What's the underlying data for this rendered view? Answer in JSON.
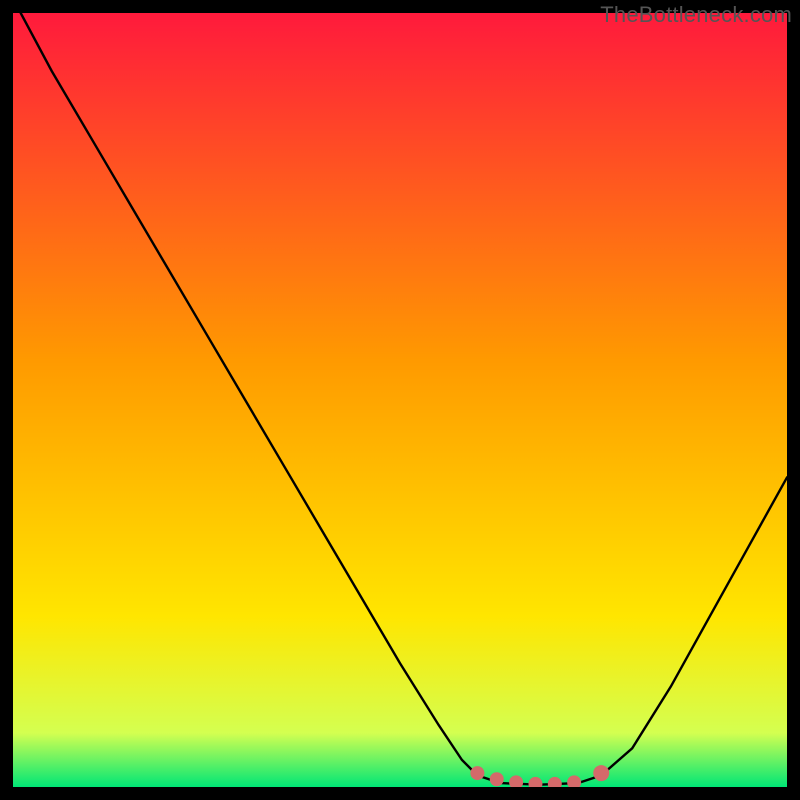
{
  "watermark": "TheBottleneck.com",
  "chart_data": {
    "type": "line",
    "title": "",
    "xlabel": "",
    "ylabel": "",
    "xlim": [
      0,
      100
    ],
    "ylim": [
      0,
      100
    ],
    "background_gradient": {
      "top": "#ff1a3c",
      "mid1": "#ff9a00",
      "mid2": "#ffe600",
      "bottom": "#00e676"
    },
    "series": [
      {
        "name": "curve",
        "color": "#000000",
        "points": [
          {
            "x": 1.0,
            "y": 100.0
          },
          {
            "x": 5.0,
            "y": 92.5
          },
          {
            "x": 10.0,
            "y": 84.0
          },
          {
            "x": 15.0,
            "y": 75.5
          },
          {
            "x": 20.0,
            "y": 67.0
          },
          {
            "x": 25.0,
            "y": 58.5
          },
          {
            "x": 30.0,
            "y": 50.0
          },
          {
            "x": 35.0,
            "y": 41.5
          },
          {
            "x": 40.0,
            "y": 33.0
          },
          {
            "x": 45.0,
            "y": 24.5
          },
          {
            "x": 50.0,
            "y": 16.0
          },
          {
            "x": 55.0,
            "y": 8.0
          },
          {
            "x": 58.0,
            "y": 3.5
          },
          {
            "x": 60.0,
            "y": 1.5
          },
          {
            "x": 63.0,
            "y": 0.5
          },
          {
            "x": 68.0,
            "y": 0.3
          },
          {
            "x": 73.0,
            "y": 0.5
          },
          {
            "x": 76.0,
            "y": 1.5
          },
          {
            "x": 80.0,
            "y": 5.0
          },
          {
            "x": 85.0,
            "y": 13.0
          },
          {
            "x": 90.0,
            "y": 22.0
          },
          {
            "x": 95.0,
            "y": 31.0
          },
          {
            "x": 100.0,
            "y": 40.0
          }
        ]
      }
    ],
    "markers": [
      {
        "name": "min-flat-left",
        "x": 60.0,
        "y": 1.8,
        "color": "#d46a6a",
        "r": 7
      },
      {
        "name": "min-flat-1",
        "x": 62.5,
        "y": 1.0,
        "color": "#d46a6a",
        "r": 7
      },
      {
        "name": "min-flat-2",
        "x": 65.0,
        "y": 0.6,
        "color": "#d46a6a",
        "r": 7
      },
      {
        "name": "min-flat-3",
        "x": 67.5,
        "y": 0.4,
        "color": "#d46a6a",
        "r": 7
      },
      {
        "name": "min-flat-4",
        "x": 70.0,
        "y": 0.4,
        "color": "#d46a6a",
        "r": 7
      },
      {
        "name": "min-flat-5",
        "x": 72.5,
        "y": 0.6,
        "color": "#d46a6a",
        "r": 7
      },
      {
        "name": "min-flat-right",
        "x": 76.0,
        "y": 1.8,
        "color": "#d46a6a",
        "r": 8
      }
    ]
  }
}
